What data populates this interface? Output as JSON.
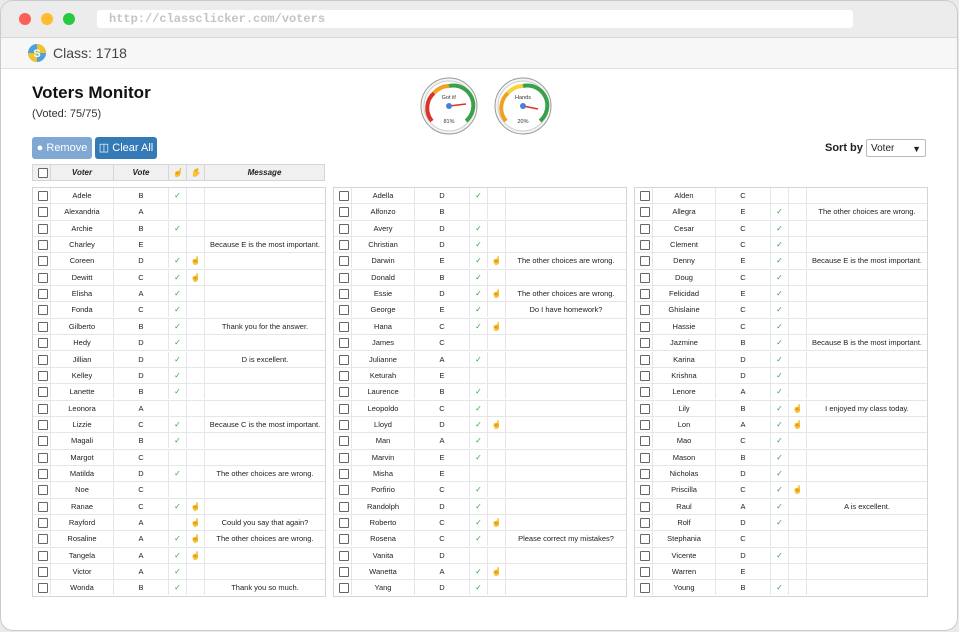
{
  "browser": {
    "url": "http://classclicker.com/voters"
  },
  "app": {
    "class_label": "Class: 1718"
  },
  "page": {
    "title": "Voters Monitor",
    "voted": "(Voted: 75/75)"
  },
  "gauges": [
    {
      "label": "Got it!",
      "percent_text": "81%",
      "value": 0.81
    },
    {
      "label": "Hands",
      "percent_text": "20%",
      "value": 0.2
    }
  ],
  "buttons": {
    "remove": "Remove",
    "clear_all": "Clear All"
  },
  "sort": {
    "label": "Sort by",
    "selected": "Voter"
  },
  "table_headers": {
    "voter": "Voter",
    "vote": "Vote",
    "message": "Message"
  },
  "columns": [
    [
      {
        "voter": "Adele",
        "vote": "B",
        "ok": true,
        "hand": false,
        "msg": ""
      },
      {
        "voter": "Alexandria",
        "vote": "A",
        "ok": false,
        "hand": false,
        "msg": ""
      },
      {
        "voter": "Archie",
        "vote": "B",
        "ok": true,
        "hand": false,
        "msg": ""
      },
      {
        "voter": "Charley",
        "vote": "E",
        "ok": false,
        "hand": false,
        "msg": "Because E is the most important."
      },
      {
        "voter": "Coreen",
        "vote": "D",
        "ok": true,
        "hand": true,
        "msg": ""
      },
      {
        "voter": "Dewitt",
        "vote": "C",
        "ok": true,
        "hand": true,
        "msg": ""
      },
      {
        "voter": "Elisha",
        "vote": "A",
        "ok": true,
        "hand": false,
        "msg": ""
      },
      {
        "voter": "Fonda",
        "vote": "C",
        "ok": true,
        "hand": false,
        "msg": ""
      },
      {
        "voter": "Gilberto",
        "vote": "B",
        "ok": true,
        "hand": false,
        "msg": "Thank you for the answer."
      },
      {
        "voter": "Hedy",
        "vote": "D",
        "ok": true,
        "hand": false,
        "msg": ""
      },
      {
        "voter": "Jillian",
        "vote": "D",
        "ok": true,
        "hand": false,
        "msg": "D is excellent."
      },
      {
        "voter": "Kelley",
        "vote": "D",
        "ok": true,
        "hand": false,
        "msg": ""
      },
      {
        "voter": "Lanette",
        "vote": "B",
        "ok": true,
        "hand": false,
        "msg": ""
      },
      {
        "voter": "Leonora",
        "vote": "A",
        "ok": false,
        "hand": false,
        "msg": ""
      },
      {
        "voter": "Lizzie",
        "vote": "C",
        "ok": true,
        "hand": false,
        "msg": "Because C is the most important."
      },
      {
        "voter": "Magali",
        "vote": "B",
        "ok": true,
        "hand": false,
        "msg": ""
      },
      {
        "voter": "Margot",
        "vote": "C",
        "ok": false,
        "hand": false,
        "msg": ""
      },
      {
        "voter": "Matilda",
        "vote": "D",
        "ok": true,
        "hand": false,
        "msg": "The other choices are wrong."
      },
      {
        "voter": "Noe",
        "vote": "C",
        "ok": false,
        "hand": false,
        "msg": ""
      },
      {
        "voter": "Ranae",
        "vote": "C",
        "ok": true,
        "hand": true,
        "msg": ""
      },
      {
        "voter": "Rayford",
        "vote": "A",
        "ok": false,
        "hand": true,
        "msg": "Could you say that again?"
      },
      {
        "voter": "Rosaline",
        "vote": "A",
        "ok": true,
        "hand": true,
        "msg": "The other choices are wrong."
      },
      {
        "voter": "Tangela",
        "vote": "A",
        "ok": true,
        "hand": true,
        "msg": ""
      },
      {
        "voter": "Victor",
        "vote": "A",
        "ok": true,
        "hand": false,
        "msg": ""
      },
      {
        "voter": "Wonda",
        "vote": "B",
        "ok": true,
        "hand": false,
        "msg": "Thank you so much."
      }
    ],
    [
      {
        "voter": "Adella",
        "vote": "D",
        "ok": true,
        "hand": false,
        "msg": ""
      },
      {
        "voter": "Alfonzo",
        "vote": "B",
        "ok": false,
        "hand": false,
        "msg": ""
      },
      {
        "voter": "Avery",
        "vote": "D",
        "ok": true,
        "hand": false,
        "msg": ""
      },
      {
        "voter": "Christian",
        "vote": "D",
        "ok": true,
        "hand": false,
        "msg": ""
      },
      {
        "voter": "Darwin",
        "vote": "E",
        "ok": true,
        "hand": true,
        "msg": "The other choices are wrong."
      },
      {
        "voter": "Donald",
        "vote": "B",
        "ok": true,
        "hand": false,
        "msg": ""
      },
      {
        "voter": "Essie",
        "vote": "D",
        "ok": true,
        "hand": true,
        "msg": "The other choices are wrong."
      },
      {
        "voter": "George",
        "vote": "E",
        "ok": true,
        "hand": false,
        "msg": "Do I have homework?"
      },
      {
        "voter": "Hana",
        "vote": "C",
        "ok": true,
        "hand": true,
        "msg": ""
      },
      {
        "voter": "James",
        "vote": "C",
        "ok": false,
        "hand": false,
        "msg": ""
      },
      {
        "voter": "Julianne",
        "vote": "A",
        "ok": true,
        "hand": false,
        "msg": ""
      },
      {
        "voter": "Keturah",
        "vote": "E",
        "ok": false,
        "hand": false,
        "msg": ""
      },
      {
        "voter": "Laurence",
        "vote": "B",
        "ok": true,
        "hand": false,
        "msg": ""
      },
      {
        "voter": "Leopoldo",
        "vote": "C",
        "ok": true,
        "hand": false,
        "msg": ""
      },
      {
        "voter": "Lloyd",
        "vote": "D",
        "ok": true,
        "hand": true,
        "msg": ""
      },
      {
        "voter": "Man",
        "vote": "A",
        "ok": true,
        "hand": false,
        "msg": ""
      },
      {
        "voter": "Marvin",
        "vote": "E",
        "ok": true,
        "hand": false,
        "msg": ""
      },
      {
        "voter": "Misha",
        "vote": "E",
        "ok": false,
        "hand": false,
        "msg": ""
      },
      {
        "voter": "Porfirio",
        "vote": "C",
        "ok": true,
        "hand": false,
        "msg": ""
      },
      {
        "voter": "Randolph",
        "vote": "D",
        "ok": true,
        "hand": false,
        "msg": ""
      },
      {
        "voter": "Roberto",
        "vote": "C",
        "ok": true,
        "hand": true,
        "msg": ""
      },
      {
        "voter": "Rosena",
        "vote": "C",
        "ok": true,
        "hand": false,
        "msg": "Please correct my mistakes?"
      },
      {
        "voter": "Vanita",
        "vote": "D",
        "ok": false,
        "hand": false,
        "msg": ""
      },
      {
        "voter": "Wanetta",
        "vote": "A",
        "ok": true,
        "hand": true,
        "msg": ""
      },
      {
        "voter": "Yang",
        "vote": "D",
        "ok": true,
        "hand": false,
        "msg": ""
      }
    ],
    [
      {
        "voter": "Alden",
        "vote": "C",
        "ok": false,
        "hand": false,
        "msg": ""
      },
      {
        "voter": "Allegra",
        "vote": "E",
        "ok": true,
        "hand": false,
        "msg": "The other choices are wrong."
      },
      {
        "voter": "Cesar",
        "vote": "C",
        "ok": true,
        "hand": false,
        "msg": ""
      },
      {
        "voter": "Clement",
        "vote": "C",
        "ok": true,
        "hand": false,
        "msg": ""
      },
      {
        "voter": "Denny",
        "vote": "E",
        "ok": true,
        "hand": false,
        "msg": "Because E is the most important."
      },
      {
        "voter": "Doug",
        "vote": "C",
        "ok": true,
        "hand": false,
        "msg": ""
      },
      {
        "voter": "Felicidad",
        "vote": "E",
        "ok": true,
        "hand": false,
        "msg": ""
      },
      {
        "voter": "Ghislaine",
        "vote": "C",
        "ok": true,
        "hand": false,
        "msg": ""
      },
      {
        "voter": "Hassie",
        "vote": "C",
        "ok": true,
        "hand": false,
        "msg": ""
      },
      {
        "voter": "Jazmine",
        "vote": "B",
        "ok": true,
        "hand": false,
        "msg": "Because B is the most important."
      },
      {
        "voter": "Karina",
        "vote": "D",
        "ok": true,
        "hand": false,
        "msg": ""
      },
      {
        "voter": "Krishna",
        "vote": "D",
        "ok": true,
        "hand": false,
        "msg": ""
      },
      {
        "voter": "Lenore",
        "vote": "A",
        "ok": true,
        "hand": false,
        "msg": ""
      },
      {
        "voter": "Lily",
        "vote": "B",
        "ok": true,
        "hand": true,
        "msg": "I enjoyed my class today."
      },
      {
        "voter": "Lon",
        "vote": "A",
        "ok": true,
        "hand": true,
        "msg": ""
      },
      {
        "voter": "Mao",
        "vote": "C",
        "ok": true,
        "hand": false,
        "msg": ""
      },
      {
        "voter": "Mason",
        "vote": "B",
        "ok": true,
        "hand": false,
        "msg": ""
      },
      {
        "voter": "Nicholas",
        "vote": "D",
        "ok": true,
        "hand": false,
        "msg": ""
      },
      {
        "voter": "Priscilla",
        "vote": "C",
        "ok": true,
        "hand": true,
        "msg": ""
      },
      {
        "voter": "Raul",
        "vote": "A",
        "ok": true,
        "hand": false,
        "msg": "A is excellent."
      },
      {
        "voter": "Rolf",
        "vote": "D",
        "ok": true,
        "hand": false,
        "msg": ""
      },
      {
        "voter": "Stephania",
        "vote": "C",
        "ok": false,
        "hand": false,
        "msg": ""
      },
      {
        "voter": "Vicente",
        "vote": "D",
        "ok": true,
        "hand": false,
        "msg": ""
      },
      {
        "voter": "Warren",
        "vote": "E",
        "ok": false,
        "hand": false,
        "msg": ""
      },
      {
        "voter": "Young",
        "vote": "B",
        "ok": true,
        "hand": false,
        "msg": ""
      }
    ]
  ],
  "icons": {
    "check": "✓",
    "hand": "☝",
    "thumb": "👍"
  }
}
